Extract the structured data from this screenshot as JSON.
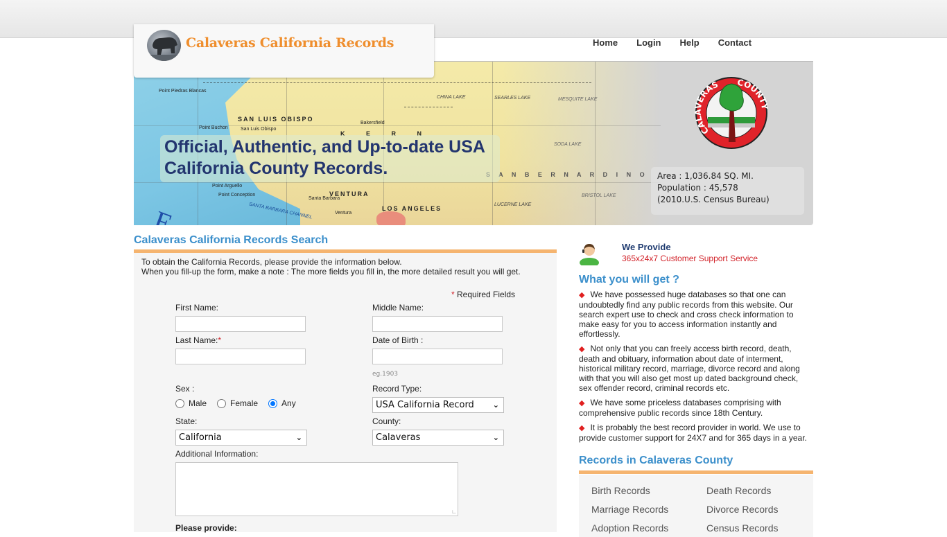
{
  "site": {
    "title": "Calaveras California Records",
    "logo_icon": "california-bear-icon"
  },
  "nav": {
    "items": [
      {
        "label": "Home"
      },
      {
        "label": "Login"
      },
      {
        "label": "Help"
      },
      {
        "label": "Contact"
      }
    ]
  },
  "banner": {
    "headline": "Official, Authentic, and Up-to-date USA California County Records.",
    "seal_icon": "calaveras-county-seal-icon",
    "seal_text_left": "CALAVERAS",
    "seal_text_right": "COUNTY",
    "stats": {
      "area": "Area : 1,036.84 SQ. MI.",
      "population": "Population : 45,578",
      "source": "(2010.U.S. Census Bureau)"
    },
    "map_labels": [
      "Point Piedras Blancas",
      "SAN LUIS OBISPO",
      "San Luis Obispo",
      "Point Buchon",
      "Bakersfield",
      "K E R N",
      "Point Arguello",
      "Point Conception",
      "SANTA BARBARA CHANNEL",
      "VENTURA",
      "LOS ANGELES",
      "S A N   B E R N A R D I N O",
      "SEARLES LAKE",
      "CHINA LAKE",
      "MESQUITE LAKE",
      "SODA LAKE",
      "BRISTOL LAKE",
      "LUCERNE LAKE",
      "Santa Barbara",
      "Ventura"
    ]
  },
  "search": {
    "title": "Calaveras California Records Search",
    "intro_line1": "To obtain the California Records, please provide the information below.",
    "intro_line2": "When you fill-up the form, make a note : The more fields you fill in, the more detailed result you will get.",
    "required_note": "Required Fields",
    "required_star": "*",
    "fields": {
      "first_name": {
        "label": "First Name:",
        "value": ""
      },
      "middle_name": {
        "label": "Middle Name:",
        "value": ""
      },
      "last_name": {
        "label": "Last Name:",
        "value": ""
      },
      "dob": {
        "label": "Date of Birth :",
        "value": "",
        "hint": "eg.1903"
      },
      "sex": {
        "label": "Sex :",
        "options": [
          "Male",
          "Female",
          "Any"
        ],
        "selected": "Any"
      },
      "record_type": {
        "label": "Record Type:",
        "value": "USA California Record"
      },
      "state": {
        "label": "State:",
        "value": "California"
      },
      "county": {
        "label": "County:",
        "value": "Calaveras"
      },
      "additional": {
        "label": "Additional Information:",
        "value": ""
      }
    },
    "please_provide": "Please provide:"
  },
  "sidebar": {
    "provide_title": "We Provide",
    "provide_sub": "365x24x7 Customer Support Service",
    "wyg_title": "What you will get ?",
    "bullets": [
      "We have possessed huge databases so that one can undoubtedly find any public records from this website. Our search expert use to check and cross check information to make easy for you to access information instantly and effortlessly.",
      "Not only that you can freely access birth record, death, death and obituary, information about date of interment, historical military record, marriage, divorce record and along with that you will also get most up dated background check, sex offender record, criminal records etc.",
      "We have some priceless databases comprising with comprehensive public records since 18th Century.",
      "It is probably the best record provider in world. We use to provide customer support for 24X7 and for 365 days in a year."
    ],
    "records_title": "Records in Calaveras County",
    "records": [
      "Birth Records",
      "Death Records",
      "Marriage Records",
      "Divorce Records",
      "Adoption Records",
      "Census Records"
    ]
  },
  "colors": {
    "brand_orange": "#ef8e2d",
    "heading_blue": "#3b8fcb",
    "headline_navy": "#23356f",
    "accent_bar": "#f5b46f",
    "required_red": "#d2232a"
  }
}
